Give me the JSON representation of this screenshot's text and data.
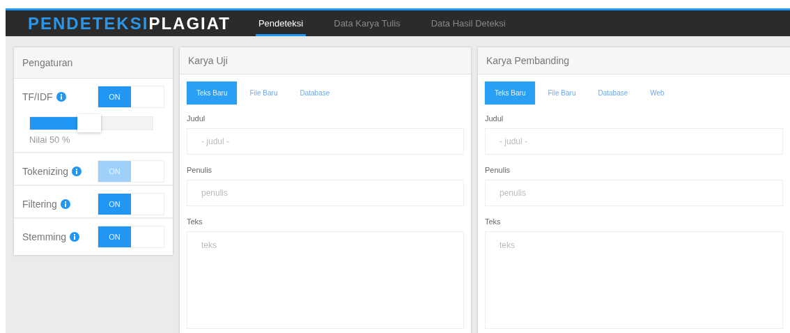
{
  "brand": {
    "part_1": "PENDETEKSI",
    "part_2": "PLAGIAT"
  },
  "nav": [
    {
      "label": "Pendeteksi",
      "selected": true
    },
    {
      "label": "Data Karya Tulis",
      "selected": false
    },
    {
      "label": "Data Hasil Deteksi",
      "selected": false
    }
  ],
  "settings": {
    "title": "Pengaturan",
    "items": [
      {
        "label": "TF/IDF",
        "toggle": "ON",
        "on": true,
        "disabled": false,
        "slider": {
          "level": 0.5,
          "reading": "Nilai  50 %"
        }
      },
      {
        "label": "Tokenizing",
        "toggle": "ON",
        "on": true,
        "disabled": true
      },
      {
        "label": "Filtering",
        "toggle": "ON",
        "on": true,
        "disabled": false
      },
      {
        "label": "Stemming",
        "toggle": "ON",
        "on": true,
        "disabled": false
      }
    ]
  },
  "panels": [
    {
      "title": "Karya Uji",
      "tabs": [
        {
          "label": "Teks Baru",
          "selected": true
        },
        {
          "label": "File Baru",
          "selected": false
        },
        {
          "label": "Database",
          "selected": false
        }
      ],
      "fields": [
        {
          "label": "Judul",
          "placeholder": "- judul -",
          "kind": "input"
        },
        {
          "label": "Penulis",
          "placeholder": "penulis",
          "kind": "input"
        },
        {
          "label": "Teks",
          "placeholder": "teks",
          "kind": "textarea"
        }
      ]
    },
    {
      "title": "Karya Pembanding",
      "tabs": [
        {
          "label": "Teks Baru",
          "selected": true
        },
        {
          "label": "File Baru",
          "selected": false
        },
        {
          "label": "Database",
          "selected": false
        },
        {
          "label": "Web",
          "selected": false
        }
      ],
      "fields": [
        {
          "label": "Judul",
          "placeholder": "- judul -",
          "kind": "input"
        },
        {
          "label": "Penulis",
          "placeholder": "penulis",
          "kind": "input"
        },
        {
          "label": "Teks",
          "placeholder": "teks",
          "kind": "textarea"
        }
      ]
    }
  ]
}
